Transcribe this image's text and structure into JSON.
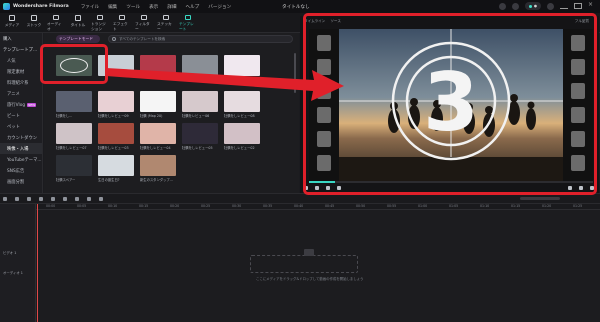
{
  "window": {
    "app_name": "Wondershare Filmora",
    "menu": [
      "ファイル",
      "編集",
      "ツール",
      "表示",
      "詳細",
      "ヘルプ",
      "バージョン"
    ],
    "doc_title": "タイトルなし"
  },
  "toolbar": {
    "items": [
      "メディア",
      "ストック",
      "オーディオ",
      "タイトル",
      "トランジション",
      "エフェクト",
      "フィルター",
      "ステッカー",
      "テンプレート"
    ],
    "active_index": 8
  },
  "sidebar": {
    "items": [
      {
        "label": "購入",
        "head": true
      },
      {
        "label": "テンプレートプ...",
        "head": true
      },
      {
        "label": "人気"
      },
      {
        "label": "限定素材"
      },
      {
        "label": "料理紹介系"
      },
      {
        "label": "アニメ"
      },
      {
        "label": "旅行Vlog",
        "badge": "NEW"
      },
      {
        "label": "ビート"
      },
      {
        "label": "ペット"
      },
      {
        "label": "カウントダウン"
      },
      {
        "label": "映像・入場",
        "selected": true
      },
      {
        "label": "YouTubeテーマ..."
      },
      {
        "label": "SNS広告"
      },
      {
        "label": "画面分割"
      }
    ]
  },
  "panel": {
    "filter_chip": "テンプレートモード",
    "search_placeholder": "すべてのテンプレートを検索"
  },
  "templates": [
    {
      "label": "",
      "color": "#4a5a52"
    },
    {
      "label": "",
      "color": "#c8cfd6"
    },
    {
      "label": "",
      "color": "#b43a4a"
    },
    {
      "label": "",
      "color": "#8a8f96"
    },
    {
      "label": "",
      "color": "#f0e8ef"
    },
    {
      "label": "牡蠣をし...",
      "color": "#5a6070"
    },
    {
      "label": "牡蠣をしレビュー09",
      "color": "#e8d0d4"
    },
    {
      "label": "牡蠣 (Map 20)",
      "color": "#f5f5f5"
    },
    {
      "label": "牡蠣をレビュー06",
      "color": "#d6c9cc"
    },
    {
      "label": "牡蠣をしレビュー08",
      "color": "#e6dce0"
    },
    {
      "label": "牡蠣をしレビュー07",
      "color": "#cfc3c7"
    },
    {
      "label": "牡蠣をしレビュー03",
      "color": "#a64c3e"
    },
    {
      "label": "牡蠣をしレビュー04",
      "color": "#e0b4a8"
    },
    {
      "label": "牡蠣をしレビュー05",
      "color": "#2e2a38"
    },
    {
      "label": "牡蠣をしレビュー02",
      "color": "#d2c0c6"
    },
    {
      "label": "牡蠣スペアー",
      "color": "#2c2f35"
    },
    {
      "label": "生日の誕生日?",
      "color": "#d6dbe0"
    },
    {
      "label": "新生のスタンダップ...",
      "color": "#b08870"
    }
  ],
  "preview": {
    "tabs": [
      "タイムライン",
      "ソース"
    ],
    "quality": "フル品質",
    "countdown_number": "3",
    "playback_position": 0.09
  },
  "timeline": {
    "ruler_labels": [
      "00:00",
      "00:05",
      "00:10",
      "00:15",
      "00:20",
      "00:25",
      "00:30",
      "00:35",
      "00:40",
      "00:45",
      "00:50",
      "00:55",
      "01:00",
      "01:05",
      "01:10",
      "01:15",
      "01:20",
      "01:25",
      "01:30"
    ],
    "tracks": [
      "ビデオ 1",
      "オーディオ 1"
    ],
    "drop_hint": "ここにメディアをドラッグ&ドロップして動画の作成を開始しましょう"
  },
  "annotations": {
    "highlight_color": "#e0202a"
  }
}
